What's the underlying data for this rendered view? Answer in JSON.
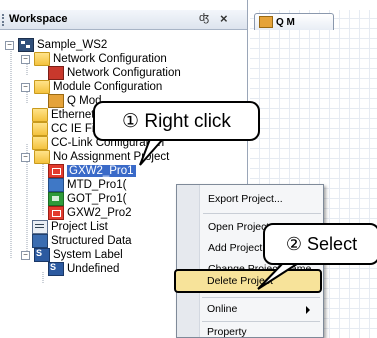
{
  "workspace": {
    "title": "Workspace",
    "pin_glyph": "4",
    "close_glyph": "×",
    "root": "Sample_WS2",
    "items": [
      {
        "label": "Network Configuration",
        "icon": "folder-icon"
      },
      {
        "label": "Network Configuration",
        "icon": "network-config-icon"
      },
      {
        "label": "Module Configuration",
        "icon": "folder-icon"
      },
      {
        "label": "Q Mod",
        "icon": "q-module-icon"
      },
      {
        "label": "Ethernet",
        "icon": "folder-icon"
      },
      {
        "label": "CC IE Field",
        "icon": "folder-icon"
      },
      {
        "label": "CC-Link Configuration",
        "icon": "folder-icon"
      },
      {
        "label": "No Assignment Project",
        "icon": "project-folder-icon"
      },
      {
        "label": "GXW2_Pro1",
        "icon": "gxworks2-project-icon"
      },
      {
        "label": "MTD_Pro1(",
        "icon": "mt-developer-project-icon"
      },
      {
        "label": "GOT_Pro1(",
        "icon": "got-project-icon"
      },
      {
        "label": "GXW2_Pro2",
        "icon": "gxworks2-project-icon"
      },
      {
        "label": "Project List",
        "icon": "project-list-icon"
      },
      {
        "label": "Structured Data",
        "icon": "structured-data-icon"
      },
      {
        "label": "System Label",
        "icon": "system-label-icon"
      },
      {
        "label": "Undefined",
        "icon": "system-label-icon"
      }
    ]
  },
  "editor_tab": {
    "label": "Q M"
  },
  "context_menu": {
    "items": [
      {
        "label": "Export Project..."
      },
      {
        "label": "Open Project"
      },
      {
        "label": "Add Project Copy..."
      },
      {
        "label": "Change Project Name"
      },
      {
        "label": "Delete Project"
      },
      {
        "label": "Online"
      },
      {
        "label": "Property"
      }
    ]
  },
  "callouts": {
    "step1": "① Right click",
    "step2": "② Select"
  },
  "colors": {
    "selection": "#3a6ac8",
    "highlight": "#f7e39a"
  }
}
